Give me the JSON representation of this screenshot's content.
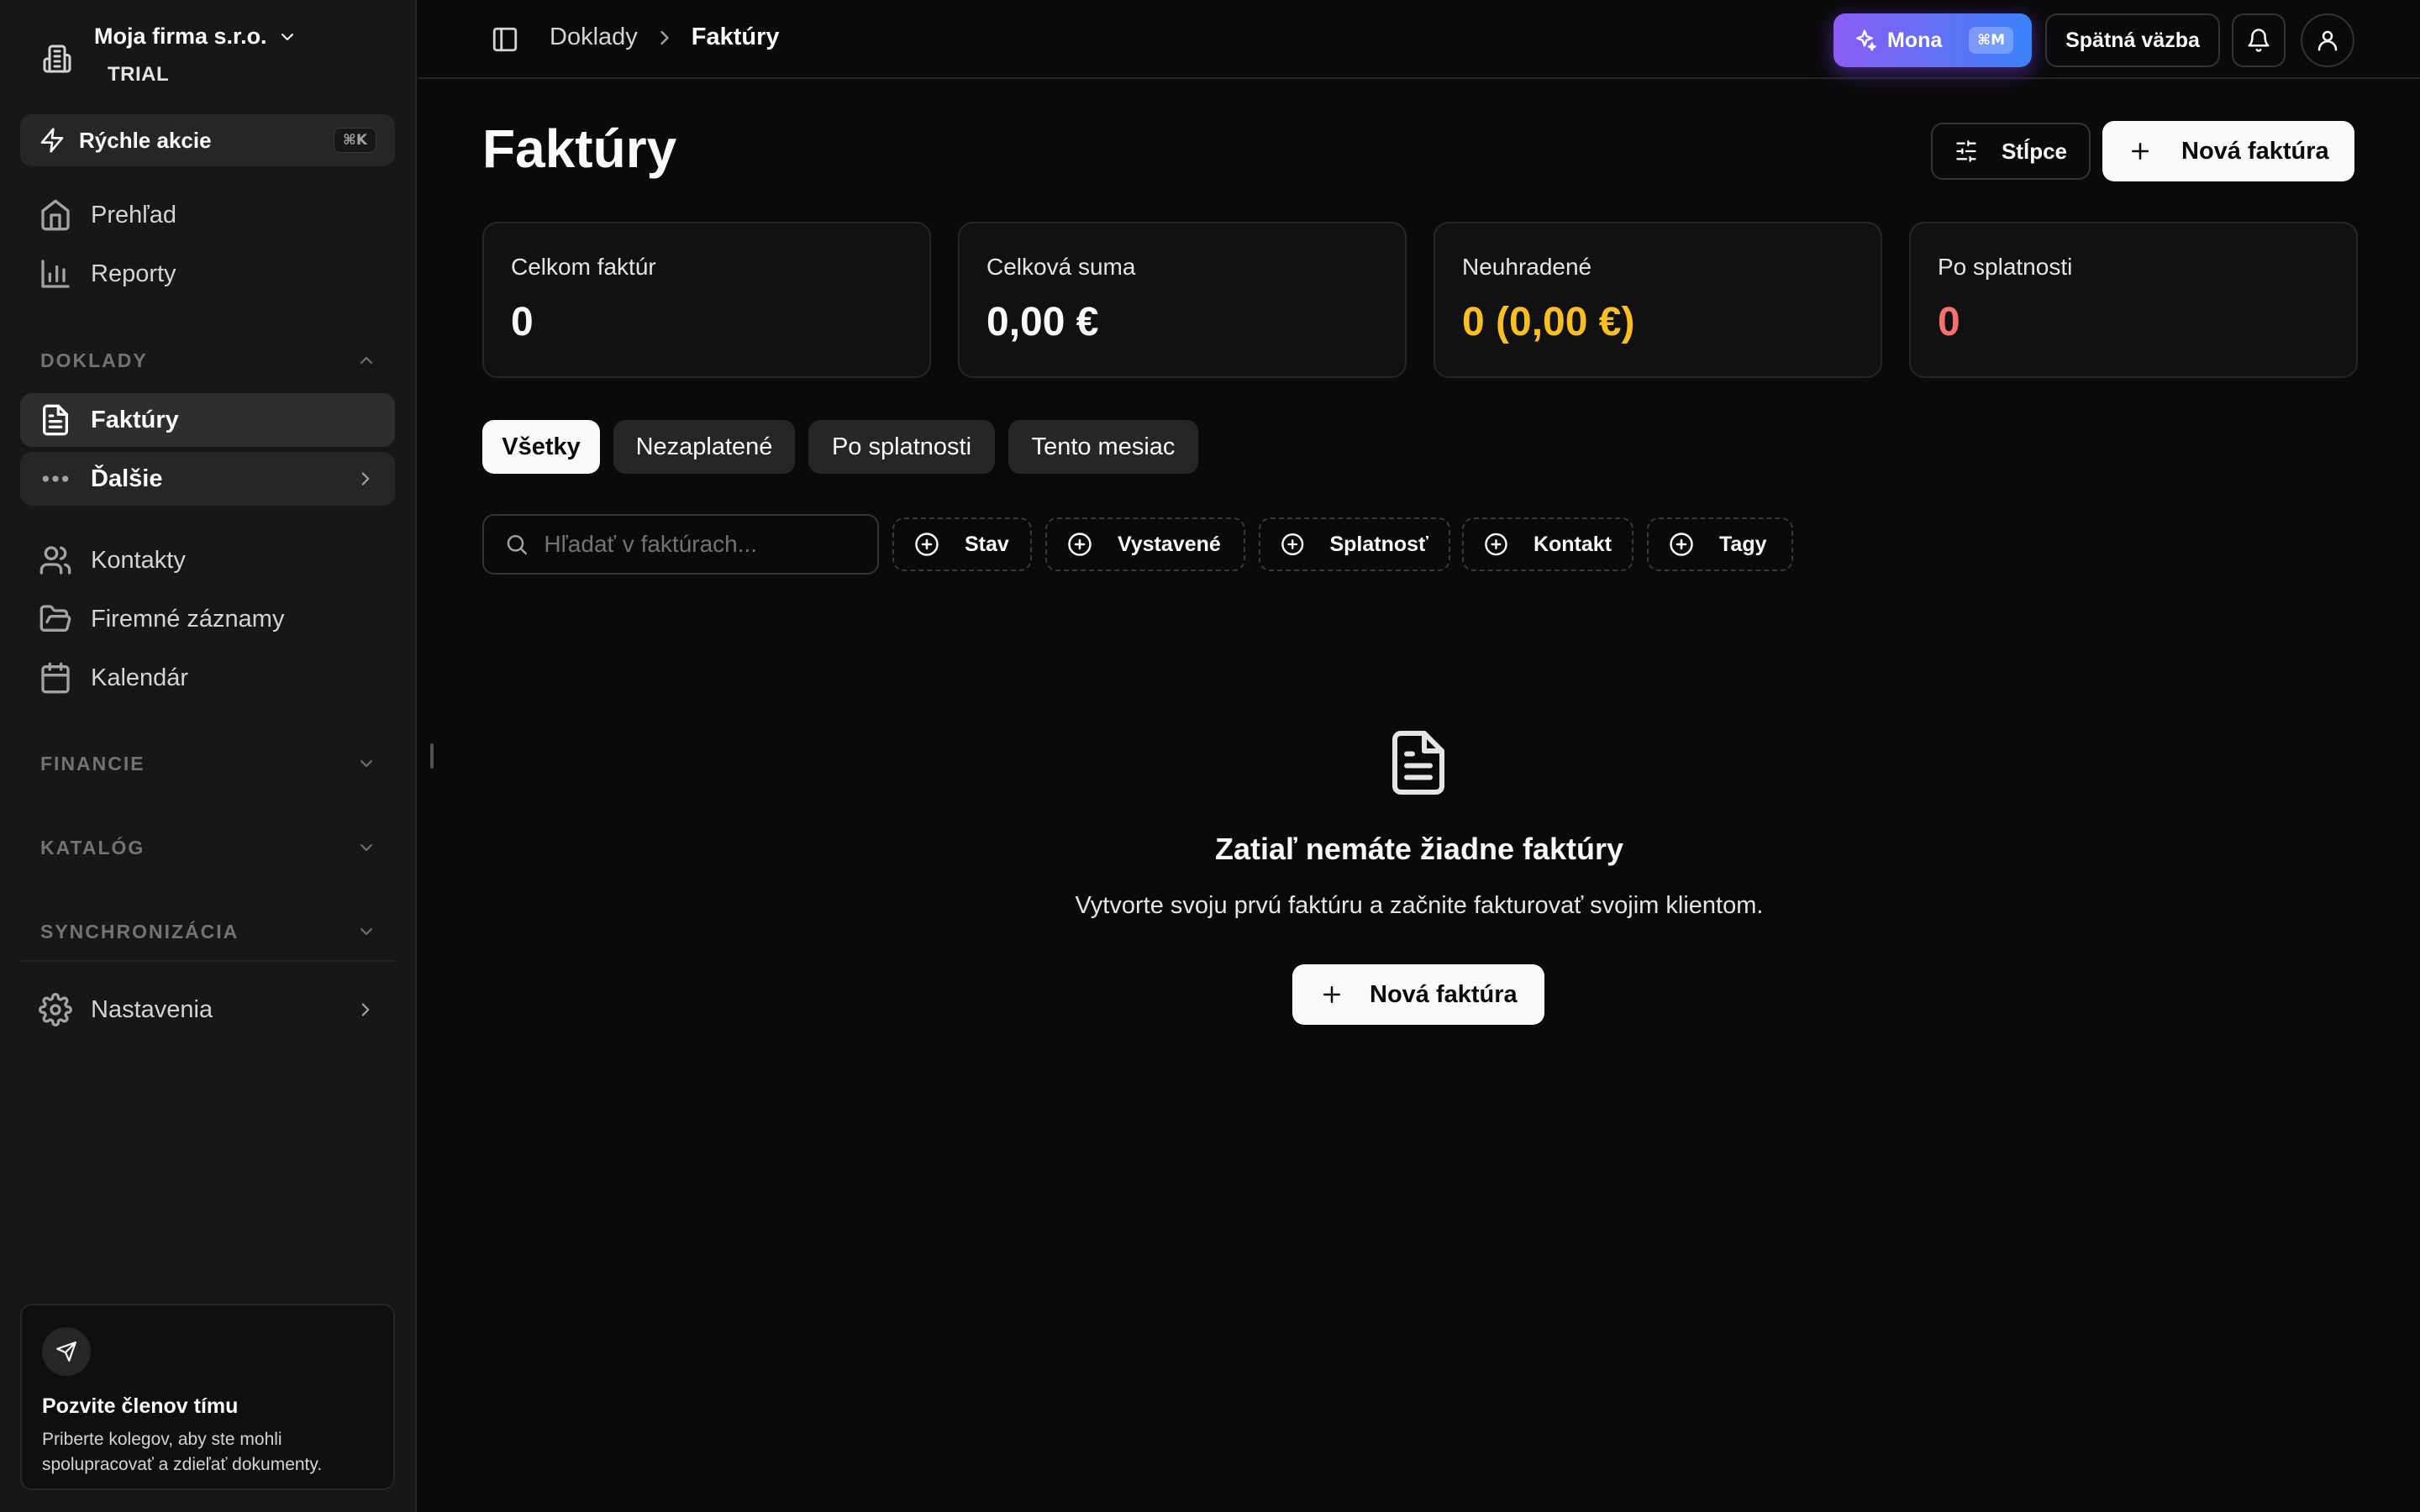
{
  "sidebar": {
    "org_name": "Moja firma s.r.o.",
    "org_plan": "TRIAL",
    "quick_actions": {
      "label": "Rýchle akcie",
      "shortcut": "⌘K"
    },
    "nav_top": [
      {
        "label": "Prehľad",
        "icon": "home-icon"
      },
      {
        "label": "Reporty",
        "icon": "bar-chart-icon"
      }
    ],
    "section_doklady": "DOKLADY",
    "doklady_items": [
      {
        "label": "Faktúry",
        "icon": "file-text-icon",
        "active": true
      },
      {
        "label": "Ďalšie",
        "icon": "more-horizontal-icon"
      }
    ],
    "nav_mid": [
      {
        "label": "Kontakty",
        "icon": "users-icon"
      },
      {
        "label": "Firemné záznamy",
        "icon": "folder-open-icon"
      },
      {
        "label": "Kalendár",
        "icon": "calendar-icon"
      }
    ],
    "section_financie": "FINANCIE",
    "section_katalog": "KATALÓG",
    "section_sync": "SYNCHRONIZÁCIA",
    "settings": {
      "label": "Nastavenia",
      "icon": "gear-icon"
    },
    "invite": {
      "title": "Pozvite členov tímu",
      "description": "Priberte kolegov, aby ste mohli spolupracovať a zdieľať dokumenty."
    }
  },
  "topbar": {
    "breadcrumb": [
      "Doklady",
      "Faktúry"
    ],
    "mona": {
      "label": "Mona",
      "shortcut": "⌘M"
    },
    "feedback_label": "Spätná väzba"
  },
  "main": {
    "title": "Faktúry",
    "columns_button": "Stĺpce",
    "new_invoice_button": "Nová faktúra",
    "stats": [
      {
        "label": "Celkom faktúr",
        "value": "0",
        "tone": "default"
      },
      {
        "label": "Celková suma",
        "value": "0,00 €",
        "tone": "default"
      },
      {
        "label": "Neuhradené",
        "value": "0 (0,00 €)",
        "tone": "warning"
      },
      {
        "label": "Po splatnosti",
        "value": "0",
        "tone": "danger"
      }
    ],
    "tabs": [
      {
        "label": "Všetky",
        "active": true
      },
      {
        "label": "Nezaplatené"
      },
      {
        "label": "Po splatnosti"
      },
      {
        "label": "Tento mesiac"
      }
    ],
    "search": {
      "placeholder": "Hľadať v faktúrach...",
      "value": ""
    },
    "filters": [
      "Stav",
      "Vystavené",
      "Splatnosť",
      "Kontakt",
      "Tagy"
    ],
    "empty_state": {
      "title": "Zatiaľ nemáte žiadne faktúry",
      "description": "Vytvorte svoju prvú faktúru a začnite fakturovať svojim klientom.",
      "button": "Nová faktúra"
    }
  },
  "colors": {
    "background": "#0a0a0a",
    "sidebar": "#171717",
    "warning": "#fbbf24",
    "danger": "#f87171",
    "mona_gradient_start": "#8b5cf6",
    "mona_gradient_end": "#3b82f6"
  }
}
